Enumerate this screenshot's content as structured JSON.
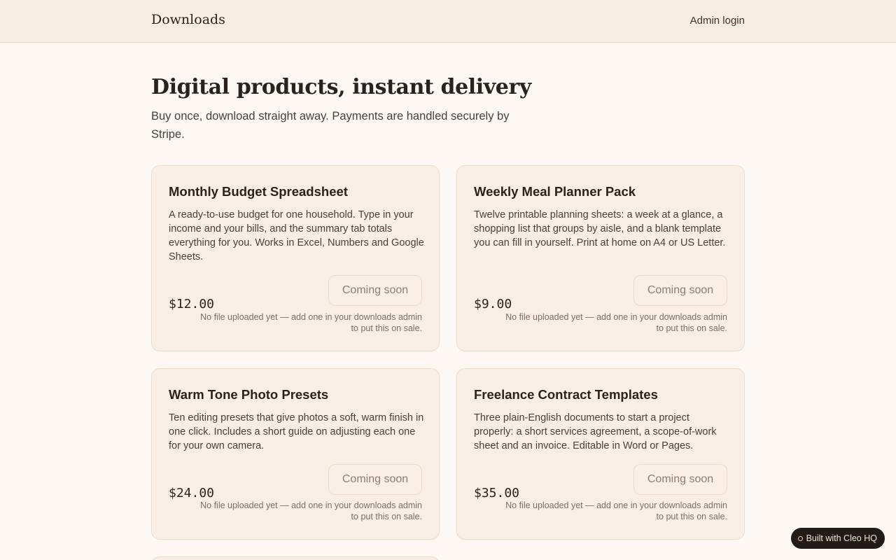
{
  "header": {
    "brand": "Downloads",
    "admin_link": "Admin login"
  },
  "hero": {
    "title": "Digital products, instant delivery",
    "subtitle": "Buy once, download straight away. Payments are handled securely by Stripe."
  },
  "products": [
    {
      "title": "Monthly Budget Spreadsheet",
      "description": "A ready-to-use budget for one household. Type in your income and your bills, and the summary tab totals everything for you. Works in Excel, Numbers and Google Sheets.",
      "price": "$12.00",
      "button": "Coming soon",
      "note": "No file uploaded yet — add one in your downloads admin to put this on sale."
    },
    {
      "title": "Weekly Meal Planner Pack",
      "description": "Twelve printable planning sheets: a week at a glance, a shopping list that groups by aisle, and a blank template you can fill in yourself. Print at home on A4 or US Letter.",
      "price": "$9.00",
      "button": "Coming soon",
      "note": "No file uploaded yet — add one in your downloads admin to put this on sale."
    },
    {
      "title": "Warm Tone Photo Presets",
      "description": "Ten editing presets that give photos a soft, warm finish in one click. Includes a short guide on adjusting each one for your own camera.",
      "price": "$24.00",
      "button": "Coming soon",
      "note": "No file uploaded yet — add one in your downloads admin to put this on sale."
    },
    {
      "title": "Freelance Contract Templates",
      "description": "Three plain-English documents to start a project properly: a short services agreement, a scope-of-work sheet and an invoice. Editable in Word or Pages.",
      "price": "$35.00",
      "button": "Coming soon",
      "note": "No file uploaded yet — add one in your downloads admin to put this on sale."
    }
  ],
  "badge": {
    "label": "Built with Cleo HQ"
  }
}
